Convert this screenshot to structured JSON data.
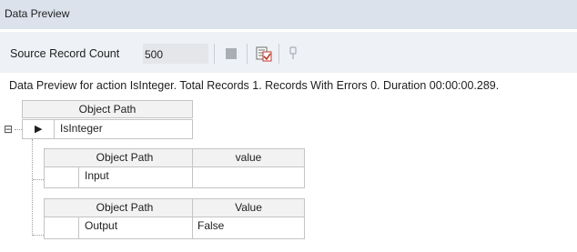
{
  "panel": {
    "title": "Data Preview"
  },
  "toolbar": {
    "source_record_label": "Source Record Count",
    "source_record_value": "500",
    "stop_icon": "stop-icon",
    "preview_icon": "preview-check-icon",
    "pin_icon": "pin-icon"
  },
  "summary": {
    "text": "Data Preview for action IsInteger. Total Records 1. Records With Errors 0. Duration 00:00:00.289."
  },
  "grid": {
    "header": {
      "col1": "Object Path"
    },
    "row": {
      "expand_glyph": "⊟",
      "selected_glyph": "▶",
      "value": "IsInteger"
    },
    "input_table": {
      "col1": "Object Path",
      "col2": "value",
      "row_label": "Input",
      "row_value": ""
    },
    "output_table": {
      "col1": "Object Path",
      "col2": "Value",
      "row_label": "Output",
      "row_value": "False"
    }
  },
  "colors": {
    "titlebar": "#dbe2ec",
    "toolbar": "#eef1f5",
    "grid_border": "#c4c4c4"
  }
}
